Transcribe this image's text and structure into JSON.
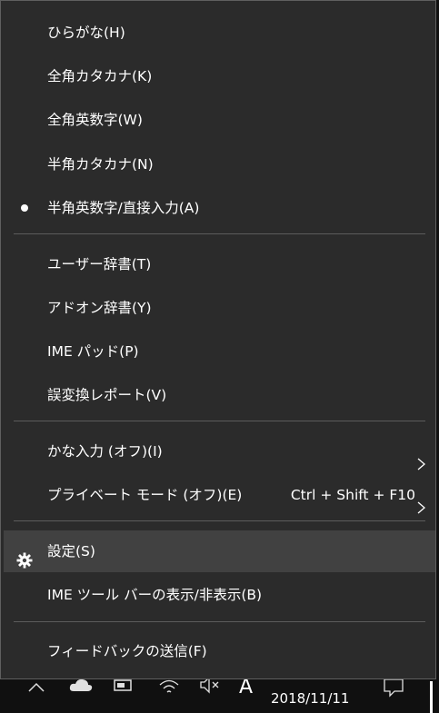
{
  "menu": {
    "items": [
      {
        "label": "ひらがな(H)"
      },
      {
        "label": "全角カタカナ(K)"
      },
      {
        "label": "全角英数字(W)"
      },
      {
        "label": "半角カタカナ(N)"
      },
      {
        "label": "半角英数字/直接入力(A)",
        "selected": true
      },
      {
        "label": "ユーザー辞書(T)"
      },
      {
        "label": "アドオン辞書(Y)"
      },
      {
        "label": "IME パッド(P)"
      },
      {
        "label": "誤変換レポート(V)"
      },
      {
        "label": "かな入力 (オフ)(I)",
        "submenu": true
      },
      {
        "label": "プライベート モード (オフ)(E)",
        "shortcut": "Ctrl + Shift + F10",
        "submenu": true
      },
      {
        "label": "設定(S)",
        "icon": "gear-icon",
        "highlighted": true
      },
      {
        "label": "IME ツール バーの表示/非表示(B)"
      },
      {
        "label": "フィードバックの送信(F)"
      }
    ]
  },
  "taskbar": {
    "date": "2018/11/11",
    "ime_mode": "A",
    "icons": [
      "chevron-up-icon",
      "onedrive-cloud-icon",
      "battery-icon",
      "wifi-icon",
      "volume-muted-icon",
      "notification-icon"
    ]
  },
  "colors": {
    "menu_bg": "#2b2b2b",
    "highlight_bg": "#414141",
    "separator": "#5c5c5c",
    "text": "#ffffff"
  }
}
